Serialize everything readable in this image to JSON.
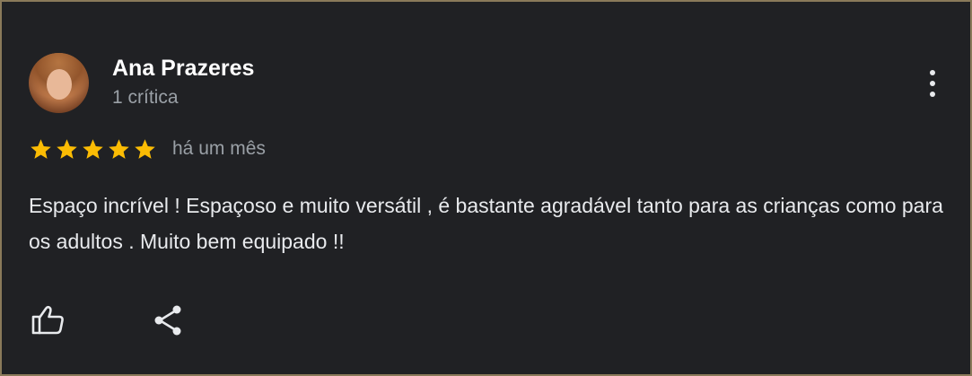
{
  "review": {
    "author_name": "Ana Prazeres",
    "author_reviews_count": "1 crítica",
    "rating": 5,
    "rating_max": 5,
    "date": "há um mês",
    "text": "Espaço incrível ! Espaçoso e muito versátil , é bastante agradável tanto para as crianças como para os adultos . Muito bem equipado !!"
  },
  "icons": {
    "menu": "more-vert-icon",
    "star": "star-icon",
    "like": "thumb-up-icon",
    "share": "share-icon"
  },
  "colors": {
    "background": "#202124",
    "star": "#fbbc04",
    "name": "#ffffff",
    "secondary_text": "#9aa0a6",
    "body_text": "#e8eaed",
    "border": "#8a7a5a"
  }
}
